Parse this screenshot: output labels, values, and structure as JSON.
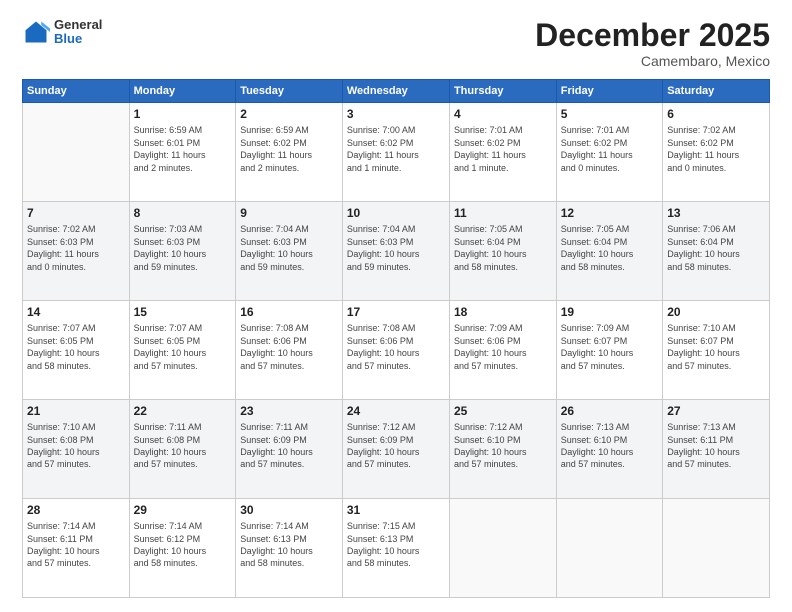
{
  "header": {
    "logo": {
      "general": "General",
      "blue": "Blue"
    },
    "month": "December 2025",
    "location": "Camembaro, Mexico"
  },
  "days_of_week": [
    "Sunday",
    "Monday",
    "Tuesday",
    "Wednesday",
    "Thursday",
    "Friday",
    "Saturday"
  ],
  "weeks": [
    [
      {
        "day": "",
        "info": ""
      },
      {
        "day": "1",
        "info": "Sunrise: 6:59 AM\nSunset: 6:01 PM\nDaylight: 11 hours\nand 2 minutes."
      },
      {
        "day": "2",
        "info": "Sunrise: 6:59 AM\nSunset: 6:02 PM\nDaylight: 11 hours\nand 2 minutes."
      },
      {
        "day": "3",
        "info": "Sunrise: 7:00 AM\nSunset: 6:02 PM\nDaylight: 11 hours\nand 1 minute."
      },
      {
        "day": "4",
        "info": "Sunrise: 7:01 AM\nSunset: 6:02 PM\nDaylight: 11 hours\nand 1 minute."
      },
      {
        "day": "5",
        "info": "Sunrise: 7:01 AM\nSunset: 6:02 PM\nDaylight: 11 hours\nand 0 minutes."
      },
      {
        "day": "6",
        "info": "Sunrise: 7:02 AM\nSunset: 6:02 PM\nDaylight: 11 hours\nand 0 minutes."
      }
    ],
    [
      {
        "day": "7",
        "info": "Sunrise: 7:02 AM\nSunset: 6:03 PM\nDaylight: 11 hours\nand 0 minutes."
      },
      {
        "day": "8",
        "info": "Sunrise: 7:03 AM\nSunset: 6:03 PM\nDaylight: 10 hours\nand 59 minutes."
      },
      {
        "day": "9",
        "info": "Sunrise: 7:04 AM\nSunset: 6:03 PM\nDaylight: 10 hours\nand 59 minutes."
      },
      {
        "day": "10",
        "info": "Sunrise: 7:04 AM\nSunset: 6:03 PM\nDaylight: 10 hours\nand 59 minutes."
      },
      {
        "day": "11",
        "info": "Sunrise: 7:05 AM\nSunset: 6:04 PM\nDaylight: 10 hours\nand 58 minutes."
      },
      {
        "day": "12",
        "info": "Sunrise: 7:05 AM\nSunset: 6:04 PM\nDaylight: 10 hours\nand 58 minutes."
      },
      {
        "day": "13",
        "info": "Sunrise: 7:06 AM\nSunset: 6:04 PM\nDaylight: 10 hours\nand 58 minutes."
      }
    ],
    [
      {
        "day": "14",
        "info": "Sunrise: 7:07 AM\nSunset: 6:05 PM\nDaylight: 10 hours\nand 58 minutes."
      },
      {
        "day": "15",
        "info": "Sunrise: 7:07 AM\nSunset: 6:05 PM\nDaylight: 10 hours\nand 57 minutes."
      },
      {
        "day": "16",
        "info": "Sunrise: 7:08 AM\nSunset: 6:06 PM\nDaylight: 10 hours\nand 57 minutes."
      },
      {
        "day": "17",
        "info": "Sunrise: 7:08 AM\nSunset: 6:06 PM\nDaylight: 10 hours\nand 57 minutes."
      },
      {
        "day": "18",
        "info": "Sunrise: 7:09 AM\nSunset: 6:06 PM\nDaylight: 10 hours\nand 57 minutes."
      },
      {
        "day": "19",
        "info": "Sunrise: 7:09 AM\nSunset: 6:07 PM\nDaylight: 10 hours\nand 57 minutes."
      },
      {
        "day": "20",
        "info": "Sunrise: 7:10 AM\nSunset: 6:07 PM\nDaylight: 10 hours\nand 57 minutes."
      }
    ],
    [
      {
        "day": "21",
        "info": "Sunrise: 7:10 AM\nSunset: 6:08 PM\nDaylight: 10 hours\nand 57 minutes."
      },
      {
        "day": "22",
        "info": "Sunrise: 7:11 AM\nSunset: 6:08 PM\nDaylight: 10 hours\nand 57 minutes."
      },
      {
        "day": "23",
        "info": "Sunrise: 7:11 AM\nSunset: 6:09 PM\nDaylight: 10 hours\nand 57 minutes."
      },
      {
        "day": "24",
        "info": "Sunrise: 7:12 AM\nSunset: 6:09 PM\nDaylight: 10 hours\nand 57 minutes."
      },
      {
        "day": "25",
        "info": "Sunrise: 7:12 AM\nSunset: 6:10 PM\nDaylight: 10 hours\nand 57 minutes."
      },
      {
        "day": "26",
        "info": "Sunrise: 7:13 AM\nSunset: 6:10 PM\nDaylight: 10 hours\nand 57 minutes."
      },
      {
        "day": "27",
        "info": "Sunrise: 7:13 AM\nSunset: 6:11 PM\nDaylight: 10 hours\nand 57 minutes."
      }
    ],
    [
      {
        "day": "28",
        "info": "Sunrise: 7:14 AM\nSunset: 6:11 PM\nDaylight: 10 hours\nand 57 minutes."
      },
      {
        "day": "29",
        "info": "Sunrise: 7:14 AM\nSunset: 6:12 PM\nDaylight: 10 hours\nand 58 minutes."
      },
      {
        "day": "30",
        "info": "Sunrise: 7:14 AM\nSunset: 6:13 PM\nDaylight: 10 hours\nand 58 minutes."
      },
      {
        "day": "31",
        "info": "Sunrise: 7:15 AM\nSunset: 6:13 PM\nDaylight: 10 hours\nand 58 minutes."
      },
      {
        "day": "",
        "info": ""
      },
      {
        "day": "",
        "info": ""
      },
      {
        "day": "",
        "info": ""
      }
    ]
  ]
}
